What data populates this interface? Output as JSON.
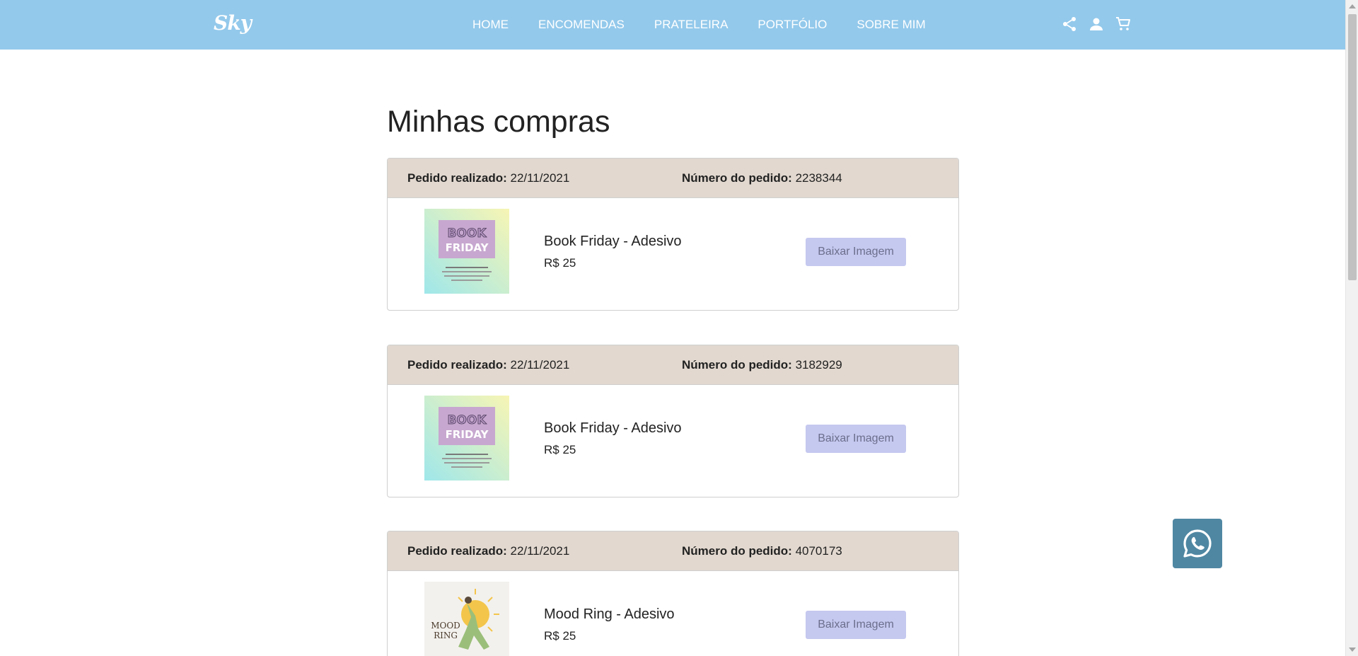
{
  "header": {
    "logo": "Sky",
    "nav": [
      "HOME",
      "ENCOMENDAS",
      "PRATELEIRA",
      "PORTFÓLIO",
      "SOBRE MIM"
    ],
    "icons": [
      "share-icon",
      "user-icon",
      "cart-icon"
    ]
  },
  "main": {
    "title": "Minhas compras",
    "date_label": "Pedido realizado:",
    "number_label": "Número do pedido:",
    "orders": [
      {
        "date": "22/11/2021",
        "number": "2238344",
        "product": "Book Friday - Adesivo",
        "price": "R$ 25",
        "button": "Baixar Imagem"
      },
      {
        "date": "22/11/2021",
        "number": "3182929",
        "product": "Book Friday - Adesivo",
        "price": "R$ 25",
        "button": "Baixar Imagem"
      },
      {
        "date": "22/11/2021",
        "number": "4070173",
        "product": "Mood Ring - Adesivo",
        "price": "R$ 25",
        "button": "Baixar Imagem"
      }
    ],
    "thumb_text": {
      "book_top": "BOOK",
      "book_bottom": "FRIDAY",
      "mood_top": "MOOD",
      "mood_bottom": "RING"
    }
  },
  "colors": {
    "header_bg": "#93c9eb",
    "order_head_bg": "#e2d8cf",
    "button_bg": "#c5c8ef",
    "whatsapp_bg": "#4f87a2"
  },
  "floating": {
    "icon": "whatsapp-icon"
  }
}
